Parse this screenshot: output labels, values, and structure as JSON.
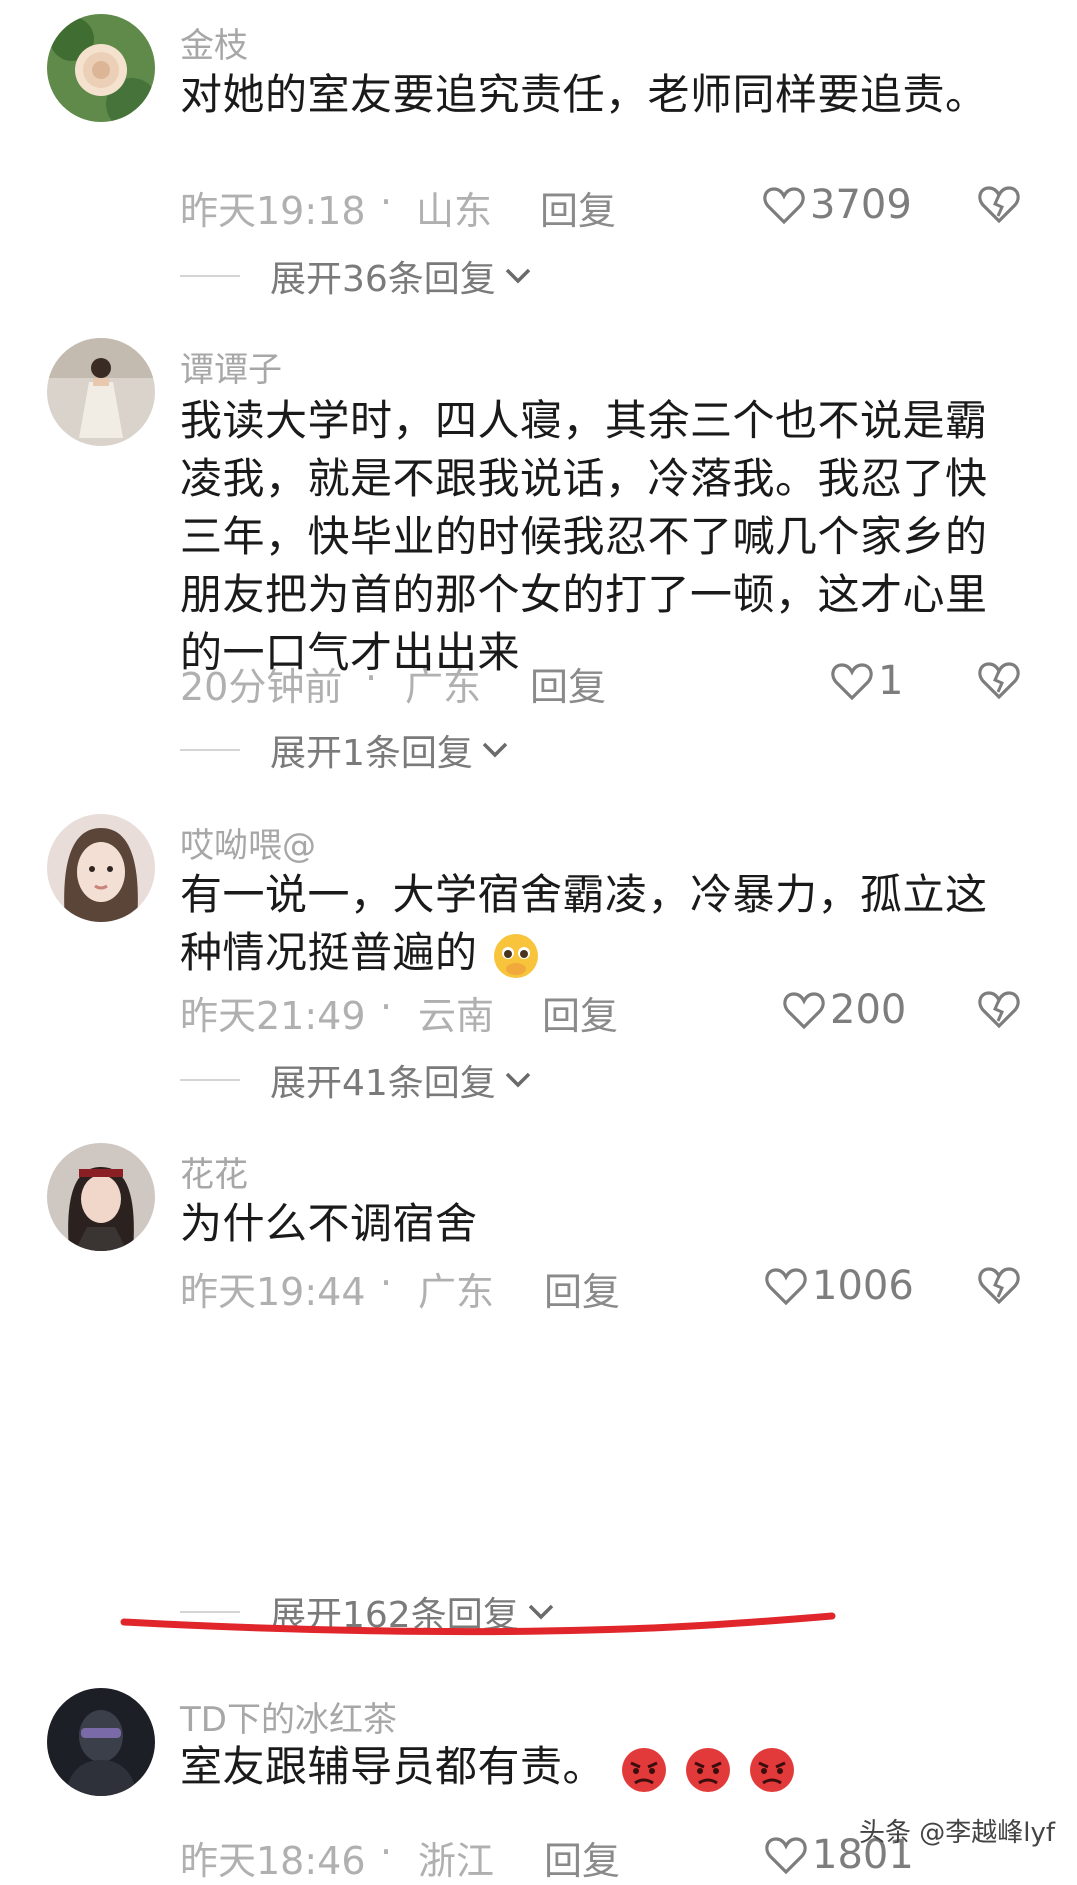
{
  "comments": [
    {
      "username": "金枝",
      "text": "对她的室友要追究责任，老师同样要追责。",
      "time": "昨天19:18",
      "region": "山东",
      "reply_label": "回复",
      "likes": "3709",
      "expand_label": "展开36条回复",
      "avatar": "rose-avatar"
    },
    {
      "username": "谭谭子",
      "text": "我读大学时，四人寝，其余三个也不说是霸凌我，就是不跟我说话，冷落我。我忍了快三年，快毕业的时候我忍不了喊几个家乡的朋友把为首的那个女的打了一顿，这才心里的一口气才出出来",
      "time": "20分钟前",
      "region": "广东",
      "reply_label": "回复",
      "likes": "1",
      "expand_label": "展开1条回复",
      "avatar": "girl-dress-avatar"
    },
    {
      "username": "哎呦喂@",
      "text": "有一说一，大学宿舍霸凌，冷暴力，孤立这种情况挺普遍的",
      "time": "昨天21:49",
      "region": "云南",
      "reply_label": "回复",
      "likes": "200",
      "expand_label": "展开41条回复",
      "avatar": "girl-face-avatar"
    },
    {
      "username": "花花",
      "text": "为什么不调宿舍",
      "time": "昨天19:44",
      "region": "广东",
      "reply_label": "回复",
      "likes": "1006",
      "expand_label": "展开162条回复",
      "avatar": "woman-portrait-avatar"
    },
    {
      "username": "TD下的冰红茶",
      "text": "室友跟辅导员都有责。",
      "time": "昨天18:46",
      "region": "浙江",
      "reply_label": "回复",
      "likes": "1801",
      "avatar": "dark-figure-avatar"
    }
  ],
  "separator": "·",
  "watermark": "头条 @李越峰lyf",
  "colors": {
    "underline": "#e0262b",
    "meta": "#b0b0b0",
    "text": "#1a1a1a"
  }
}
